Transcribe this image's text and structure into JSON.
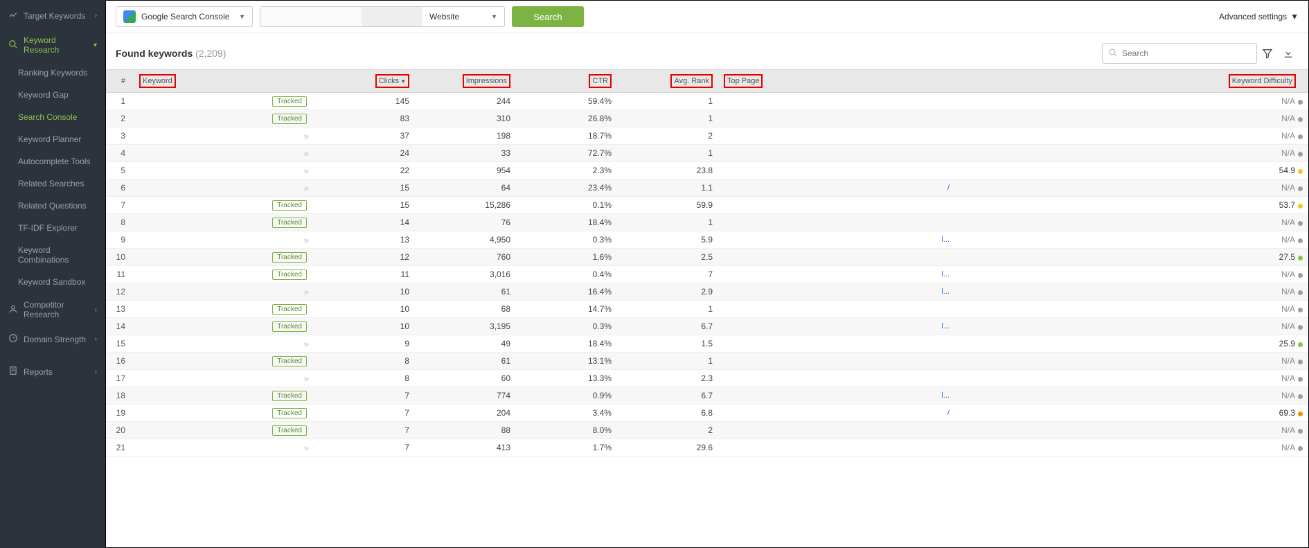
{
  "sidebar": {
    "items": [
      {
        "label": "Target Keywords",
        "kind": "top",
        "icon": "chart"
      },
      {
        "label": "Keyword Research",
        "kind": "top",
        "active": true,
        "icon": "magnify"
      },
      {
        "label": "Ranking Keywords",
        "kind": "sub"
      },
      {
        "label": "Keyword Gap",
        "kind": "sub"
      },
      {
        "label": "Search Console",
        "kind": "sub",
        "selected": true
      },
      {
        "label": "Keyword Planner",
        "kind": "sub"
      },
      {
        "label": "Autocomplete Tools",
        "kind": "sub"
      },
      {
        "label": "Related Searches",
        "kind": "sub"
      },
      {
        "label": "Related Questions",
        "kind": "sub"
      },
      {
        "label": "TF-IDF Explorer",
        "kind": "sub"
      },
      {
        "label": "Keyword Combinations",
        "kind": "sub"
      },
      {
        "label": "Keyword Sandbox",
        "kind": "sub"
      },
      {
        "label": "Competitor Research",
        "kind": "top",
        "icon": "user"
      },
      {
        "label": "Domain Strength",
        "kind": "top",
        "icon": "gauge"
      },
      {
        "label": "Reports",
        "kind": "top",
        "icon": "doc"
      }
    ]
  },
  "toolbar": {
    "gsc_label": "Google Search Console",
    "website_label": "Website",
    "search_btn": "Search",
    "advanced": "Advanced settings"
  },
  "subheader": {
    "found_label": "Found keywords",
    "count_text": "(2,209)",
    "search_placeholder": "Search"
  },
  "columns": {
    "num": "#",
    "keyword": "Keyword",
    "clicks": "Clicks",
    "impressions": "Impressions",
    "ctr": "CTR",
    "rank": "Avg. Rank",
    "top": "Top Page",
    "diff": "Keyword Difficulty"
  },
  "rows": [
    {
      "n": 1,
      "tag": "Tracked",
      "clicks": "145",
      "imp": "244",
      "ctr": "59.4%",
      "rank": "1",
      "top": "",
      "diff": "N/A",
      "dot": "gray"
    },
    {
      "n": 2,
      "tag": "Tracked",
      "clicks": "83",
      "imp": "310",
      "ctr": "26.8%",
      "rank": "1",
      "top": "",
      "diff": "N/A",
      "dot": "gray"
    },
    {
      "n": 3,
      "tag": "chev",
      "clicks": "37",
      "imp": "198",
      "ctr": "18.7%",
      "rank": "2",
      "top": "",
      "diff": "N/A",
      "dot": "gray"
    },
    {
      "n": 4,
      "tag": "chev",
      "clicks": "24",
      "imp": "33",
      "ctr": "72.7%",
      "rank": "1",
      "top": "",
      "diff": "N/A",
      "dot": "gray"
    },
    {
      "n": 5,
      "tag": "chev",
      "clicks": "22",
      "imp": "954",
      "ctr": "2.3%",
      "rank": "23.8",
      "top": "",
      "diff": "54.9",
      "dot": "yellow"
    },
    {
      "n": 6,
      "tag": "chev",
      "clicks": "15",
      "imp": "64",
      "ctr": "23.4%",
      "rank": "1.1",
      "top": "/",
      "diff": "N/A",
      "dot": "gray"
    },
    {
      "n": 7,
      "tag": "Tracked",
      "clicks": "15",
      "imp": "15,286",
      "ctr": "0.1%",
      "rank": "59.9",
      "top": "",
      "diff": "53.7",
      "dot": "yellow"
    },
    {
      "n": 8,
      "tag": "Tracked",
      "clicks": "14",
      "imp": "76",
      "ctr": "18.4%",
      "rank": "1",
      "top": "",
      "diff": "N/A",
      "dot": "gray"
    },
    {
      "n": 9,
      "tag": "chev",
      "clicks": "13",
      "imp": "4,950",
      "ctr": "0.3%",
      "rank": "5.9",
      "top": "l...",
      "diff": "N/A",
      "dot": "gray"
    },
    {
      "n": 10,
      "tag": "Tracked",
      "clicks": "12",
      "imp": "760",
      "ctr": "1.6%",
      "rank": "2.5",
      "top": "",
      "diff": "27.5",
      "dot": "green"
    },
    {
      "n": 11,
      "tag": "Tracked",
      "clicks": "11",
      "imp": "3,016",
      "ctr": "0.4%",
      "rank": "7",
      "top": "l...",
      "diff": "N/A",
      "dot": "gray"
    },
    {
      "n": 12,
      "tag": "chev",
      "clicks": "10",
      "imp": "61",
      "ctr": "16.4%",
      "rank": "2.9",
      "top": "l...",
      "diff": "N/A",
      "dot": "gray"
    },
    {
      "n": 13,
      "tag": "Tracked",
      "clicks": "10",
      "imp": "68",
      "ctr": "14.7%",
      "rank": "1",
      "top": "",
      "diff": "N/A",
      "dot": "gray"
    },
    {
      "n": 14,
      "tag": "Tracked",
      "clicks": "10",
      "imp": "3,195",
      "ctr": "0.3%",
      "rank": "6.7",
      "top": "l...",
      "diff": "N/A",
      "dot": "gray"
    },
    {
      "n": 15,
      "tag": "chev",
      "clicks": "9",
      "imp": "49",
      "ctr": "18.4%",
      "rank": "1.5",
      "top": "",
      "diff": "25.9",
      "dot": "green"
    },
    {
      "n": 16,
      "tag": "Tracked",
      "clicks": "8",
      "imp": "61",
      "ctr": "13.1%",
      "rank": "1",
      "top": "",
      "diff": "N/A",
      "dot": "gray"
    },
    {
      "n": 17,
      "tag": "chev",
      "clicks": "8",
      "imp": "60",
      "ctr": "13.3%",
      "rank": "2.3",
      "top": "",
      "diff": "N/A",
      "dot": "gray"
    },
    {
      "n": 18,
      "tag": "Tracked",
      "clicks": "7",
      "imp": "774",
      "ctr": "0.9%",
      "rank": "6.7",
      "top": "l...",
      "diff": "N/A",
      "dot": "gray"
    },
    {
      "n": 19,
      "tag": "Tracked",
      "clicks": "7",
      "imp": "204",
      "ctr": "3.4%",
      "rank": "6.8",
      "top": "/",
      "diff": "69.3",
      "dot": "orange"
    },
    {
      "n": 20,
      "tag": "Tracked",
      "clicks": "7",
      "imp": "88",
      "ctr": "8.0%",
      "rank": "2",
      "top": "",
      "diff": "N/A",
      "dot": "gray"
    },
    {
      "n": 21,
      "tag": "chev",
      "clicks": "7",
      "imp": "413",
      "ctr": "1.7%",
      "rank": "29.6",
      "top": "",
      "diff": "N/A",
      "dot": "gray"
    }
  ]
}
